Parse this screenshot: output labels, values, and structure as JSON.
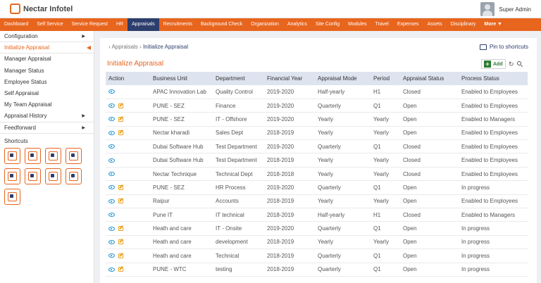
{
  "header": {
    "logo_text": "Nectar Infotel",
    "user_name": "Super Admin"
  },
  "topnav": {
    "items": [
      "Dashboard",
      "Self Service",
      "Service Request",
      "HR",
      "Appraisals",
      "Recruitments",
      "Background Check",
      "Organization",
      "Analytics",
      "Site Config",
      "Modules",
      "Travel",
      "Expenses",
      "Assets",
      "Disciplinary"
    ],
    "active": "Appraisals",
    "more_label": "More ▼"
  },
  "sidebar": {
    "items": [
      {
        "label": "Configuration",
        "caret": "▶"
      },
      {
        "label": "Initialize Appraisal",
        "caret": "◀"
      },
      {
        "label": "Manager Appraisal",
        "caret": ""
      },
      {
        "label": "Manager Status",
        "caret": ""
      },
      {
        "label": "Employee Status",
        "caret": ""
      },
      {
        "label": "Self Appraisal",
        "caret": ""
      },
      {
        "label": "My Team Appraisal",
        "caret": ""
      },
      {
        "label": "Appraisal History",
        "caret": "▶"
      },
      {
        "label": "Feedforward",
        "caret": "▶"
      }
    ],
    "shortcuts_title": "Shortcuts",
    "shortcut_icons": [
      "search-user-icon",
      "building-icon",
      "boxes-icon",
      "team-icon",
      "calendar-team-icon",
      "calendar-icon",
      "id-card-icon",
      "form-icon",
      "money-search-icon"
    ]
  },
  "main": {
    "breadcrumb": {
      "sep": "›",
      "parent": "Appraisals",
      "current": "Initialize Appraisal"
    },
    "pin_label": "Pin to shortcuts",
    "page_title": "Initialize Appraisal",
    "add_label": "Add",
    "refresh_glyph": "↻"
  },
  "table": {
    "columns": [
      "Action",
      "Business Unit",
      "Department",
      "Financial Year",
      "Appraisal Mode",
      "Period",
      "Appraisal Status",
      "Process Status"
    ],
    "rows": [
      {
        "edit": false,
        "cells": [
          "APAC Innovation Lab",
          "Quality Control",
          "2019-2020",
          "Half-yearly",
          "H1",
          "Closed",
          "Enabled to Employees"
        ]
      },
      {
        "edit": true,
        "cells": [
          "PUNE - SEZ",
          "Finance",
          "2019-2020",
          "Quarterly",
          "Q1",
          "Open",
          "Enabled to Employees"
        ]
      },
      {
        "edit": true,
        "cells": [
          "PUNE - SEZ",
          "IT - Offshore",
          "2019-2020",
          "Yearly",
          "Yearly",
          "Open",
          "Enabled to Managers"
        ]
      },
      {
        "edit": true,
        "cells": [
          "Nectar kharadi",
          "Sales Dept",
          "2018-2019",
          "Yearly",
          "Yearly",
          "Open",
          "Enabled to Employees"
        ]
      },
      {
        "edit": false,
        "cells": [
          "Dubai Software Hub",
          "Test Department",
          "2019-2020",
          "Quarterly",
          "Q1",
          "Closed",
          "Enabled to Employees"
        ]
      },
      {
        "edit": false,
        "cells": [
          "Dubai Software Hub",
          "Test Department",
          "2018-2019",
          "Yearly",
          "Yearly",
          "Closed",
          "Enabled to Employees"
        ]
      },
      {
        "edit": false,
        "cells": [
          "Nectar Technique",
          "Technical Dept",
          "2018-2018",
          "Yearly",
          "Yearly",
          "Closed",
          "Enabled to Employees"
        ]
      },
      {
        "edit": true,
        "cells": [
          "PUNE - SEZ",
          "HR Process",
          "2019-2020",
          "Quarterly",
          "Q1",
          "Open",
          "In progress"
        ]
      },
      {
        "edit": true,
        "cells": [
          "Raipur",
          "Accounts",
          "2018-2019",
          "Yearly",
          "Yearly",
          "Open",
          "Enabled to Employees"
        ]
      },
      {
        "edit": false,
        "cells": [
          "Pune IT",
          "IT technical",
          "2018-2019",
          "Half-yearly",
          "H1",
          "Closed",
          "Enabled to Managers"
        ]
      },
      {
        "edit": true,
        "cells": [
          "Heath and care",
          "IT - Onsite",
          "2019-2020",
          "Quarterly",
          "Q1",
          "Open",
          "In progress"
        ]
      },
      {
        "edit": true,
        "cells": [
          "Heath and care",
          "development",
          "2018-2019",
          "Yearly",
          "Yearly",
          "Open",
          "In progress"
        ]
      },
      {
        "edit": true,
        "cells": [
          "Heath and care",
          "Technical",
          "2018-2019",
          "Quarterly",
          "Q1",
          "Open",
          "In progress"
        ]
      },
      {
        "edit": true,
        "cells": [
          "PUNE - WTC",
          "testing",
          "2018-2019",
          "Quarterly",
          "Q1",
          "Open",
          "In progress"
        ]
      }
    ]
  },
  "colors": {
    "accent": "#e8651e",
    "nav_active": "#2c3e6b",
    "header_row": "#dde3ef",
    "view_icon": "#1a8fd0",
    "edit_icon": "#e8a020",
    "add_green": "#2e7d32"
  }
}
